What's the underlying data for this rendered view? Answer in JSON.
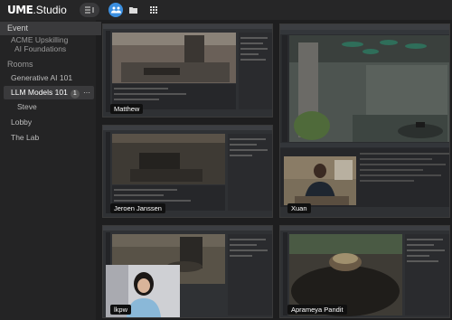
{
  "app": {
    "brand": "UME",
    "suffix": ".Studio"
  },
  "toolbar": {
    "collapse_icon": "collapse-sidebar-icon",
    "people_icon": "people-icon",
    "folder_icon": "folder-icon",
    "grid_icon": "grid-icon"
  },
  "sidebar": {
    "event_heading": "Event",
    "event_name_line1": "ACME Upskilling",
    "event_name_line2": "AI Foundations",
    "rooms_heading": "Rooms",
    "rooms": [
      {
        "label": "Generative AI 101"
      },
      {
        "label": "LLM Models 101",
        "badge": "1",
        "more": "···"
      },
      {
        "label": "Steve"
      },
      {
        "label": "Lobby"
      },
      {
        "label": "The Lab"
      }
    ]
  },
  "tiles": [
    {
      "name": "Matthew"
    },
    {
      "name": "Jeroen Janssen"
    },
    {
      "name": "Xuan"
    },
    {
      "name": "lkpw"
    },
    {
      "name": "Aprameya Pandit"
    }
  ],
  "colors": {
    "accent": "#3b8fe0",
    "background": "#1e1e1f"
  }
}
